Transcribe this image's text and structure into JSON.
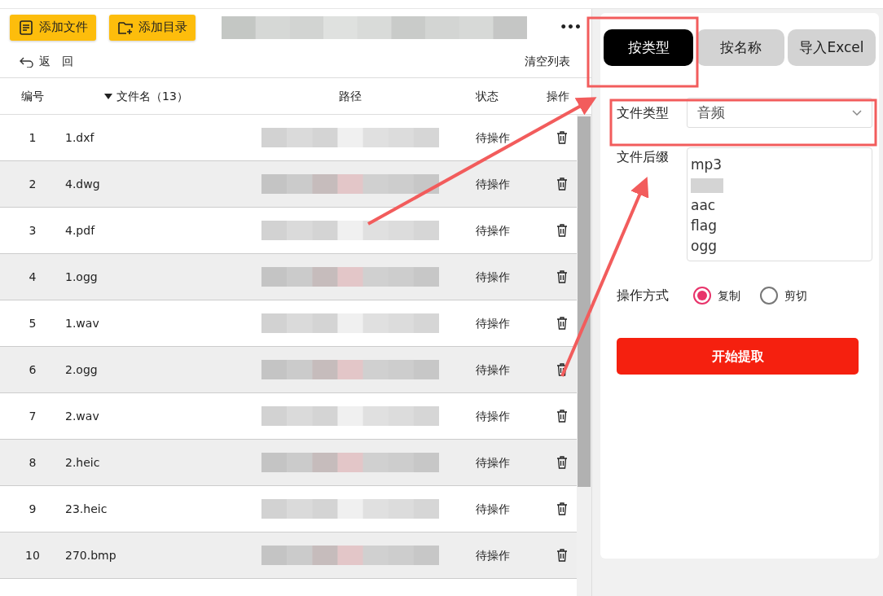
{
  "toolbar": {
    "buttons": [
      {
        "label": "添加文件",
        "kind": "file"
      },
      {
        "label": "添加目录",
        "kind": "folder"
      }
    ],
    "path_field": {
      "blurred": true
    },
    "more_button": "•••"
  },
  "back_link": {
    "label": "返　回"
  },
  "clear_link": "清空列表",
  "table": {
    "columns": [
      {
        "label": "编号",
        "sorted": false
      },
      {
        "label": "文件名（13）",
        "sorted": true
      },
      {
        "label": "路径",
        "sorted": false
      },
      {
        "label": "状态",
        "sorted": false
      },
      {
        "label": "操作",
        "sorted": false
      }
    ],
    "rows": [
      {
        "number": "1",
        "name": "1.dxf",
        "path_blurred": true,
        "status": "待操作"
      },
      {
        "number": "2",
        "name": "4.dwg",
        "path_blurred": true,
        "status": "待操作"
      },
      {
        "number": "3",
        "name": "4.pdf",
        "path_blurred": true,
        "status": "待操作"
      },
      {
        "number": "4",
        "name": "1.ogg",
        "path_blurred": true,
        "status": "待操作"
      },
      {
        "number": "5",
        "name": "1.wav",
        "path_blurred": true,
        "status": "待操作"
      },
      {
        "number": "6",
        "name": "2.ogg",
        "path_blurred": true,
        "status": "待操作"
      },
      {
        "number": "7",
        "name": "2.wav",
        "path_blurred": true,
        "status": "待操作"
      },
      {
        "number": "8",
        "name": "2.heic",
        "path_blurred": true,
        "status": "待操作"
      },
      {
        "number": "9",
        "name": "23.heic",
        "path_blurred": true,
        "status": "待操作"
      },
      {
        "number": "10",
        "name": "270.bmp",
        "path_blurred": true,
        "status": "待操作"
      }
    ]
  },
  "tabs": [
    {
      "label": "按类型",
      "selected": true
    },
    {
      "label": "按名称",
      "selected": false
    },
    {
      "label": "导入Excel",
      "selected": false
    }
  ],
  "file_type": {
    "label": "文件类型",
    "value": "音频"
  },
  "suffix": {
    "label": "文件后缀",
    "lines": [
      {
        "kind": "text",
        "text": "mp3"
      },
      {
        "kind": "blurred"
      },
      {
        "kind": "text",
        "text": "aac"
      },
      {
        "kind": "text",
        "text": "flag"
      },
      {
        "kind": "text",
        "text": "ogg"
      }
    ]
  },
  "operation": {
    "label": "操作方式",
    "options": [
      {
        "label": "复制",
        "selected": true
      },
      {
        "label": "剪切",
        "selected": false
      }
    ]
  },
  "start_button": "开始提取",
  "callouts": [
    {
      "kind": "box"
    },
    {
      "kind": "box"
    },
    {
      "kind": "arrow"
    },
    {
      "kind": "arrow"
    }
  ]
}
